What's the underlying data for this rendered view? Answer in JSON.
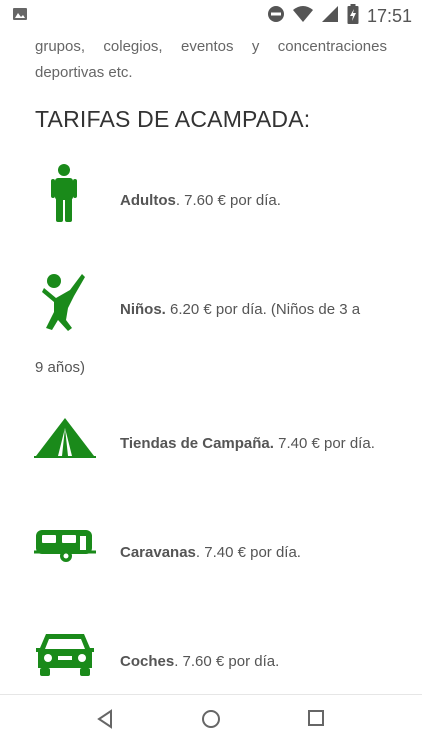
{
  "status": {
    "time": "17:51"
  },
  "intro": {
    "text": "grupos, colegios, eventos y concentraciones deportivas etc."
  },
  "section": {
    "title": "TARIFAS DE ACAMPADA:"
  },
  "rates": [
    {
      "label": "Adultos",
      "text": ". 7.60 € por día."
    },
    {
      "label": "Niños.",
      "text": " 6.20 € por día. (Niños de 3 a",
      "continuation": "9 años)"
    },
    {
      "label": "Tiendas de Campaña.",
      "text": " 7.40 € por día."
    },
    {
      "label": "Caravanas",
      "text": ". 7.40 € por día."
    },
    {
      "label": "Coches",
      "text": ". 7.60 € por día."
    }
  ],
  "icons": {
    "adult": "person-icon",
    "child": "child-jumping-icon",
    "tent": "tent-icon",
    "caravan": "caravan-icon",
    "car": "car-icon"
  },
  "colors": {
    "icon_green": "#1a8a1a"
  }
}
